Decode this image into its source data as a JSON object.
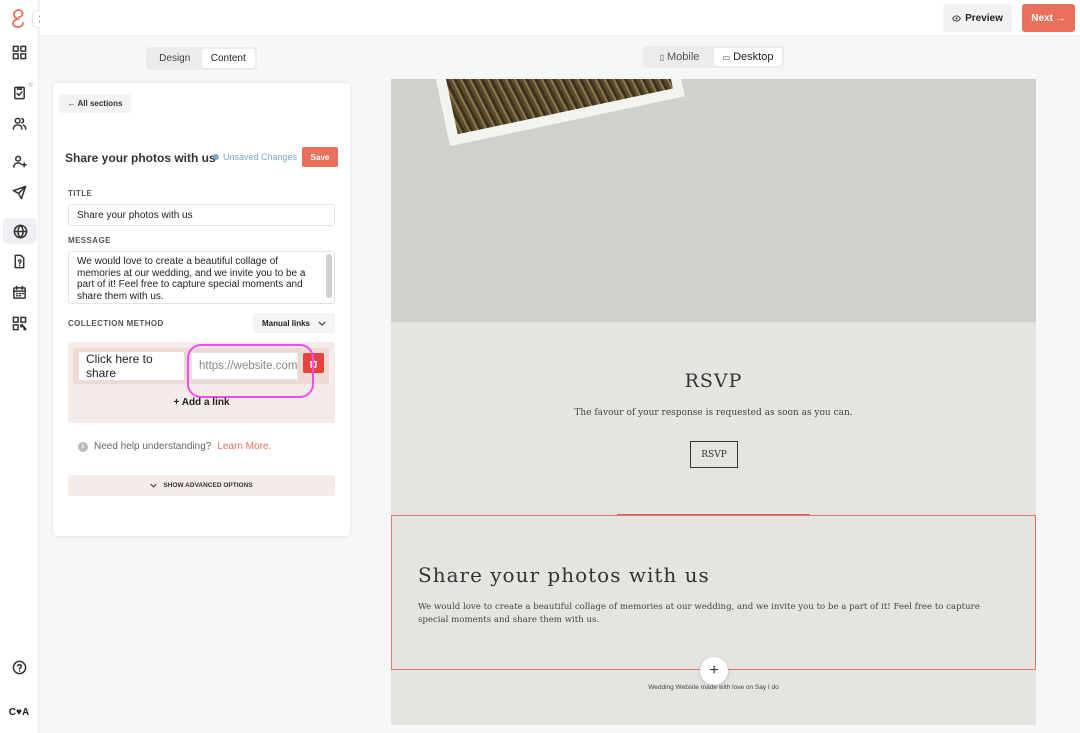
{
  "topbar": {
    "preview_label": "Preview",
    "next_label": "Next →"
  },
  "sidebar": {
    "icons": [
      "dashboard-icon",
      "checklist-icon",
      "guests-icon",
      "contacts-icon",
      "send-icon",
      "website-icon",
      "document-icon",
      "calendar-icon",
      "qr-code-icon",
      "help-icon"
    ],
    "user_initials": "C♥A"
  },
  "editor_tabs": [
    "Design",
    "Content"
  ],
  "active_editor_tab": "Content",
  "view_toggle": {
    "mobile_label": "Mobile",
    "desktop_label": "Desktop",
    "active": "Desktop"
  },
  "panel": {
    "back_label": "← All sections",
    "section_title": "Share your photos with us",
    "status": "Unsaved Changes",
    "save_label": "Save",
    "title_label": "TITLE",
    "title_value": "Share your photos with us",
    "message_label": "MESSAGE",
    "message_value": "We would love to create a beautiful collage of memories at our wedding, and we invite you to be a part of it! Feel free to capture special moments and share them with us.",
    "collection_label": "COLLECTION METHOD",
    "collection_value": "Manual links",
    "link_text": "Click here to share",
    "link_url_placeholder": "https://website.com",
    "add_link_label": "+ Add a link",
    "help_text": "Need help understanding?",
    "help_link": "Learn More.",
    "advanced_label": "SHOW ADVANCED OPTIONS"
  },
  "site_preview": {
    "rsvp_title": "RSVP",
    "rsvp_subtitle": "The favour of your response is requested as soon as you can.",
    "rsvp_button": "RSVP",
    "share_title": "Share your photos with us",
    "share_message": "We would love to create a beautiful collage of memories at our wedding, and we invite you to be a part of it! Feel free to capture special moments and share them with us.",
    "add_section": "+",
    "footer": "Wedding Website made with love on Say I do"
  },
  "colors": {
    "accent": "#e8705d",
    "status": "#7aa7c9",
    "highlight": "#f04df0"
  }
}
